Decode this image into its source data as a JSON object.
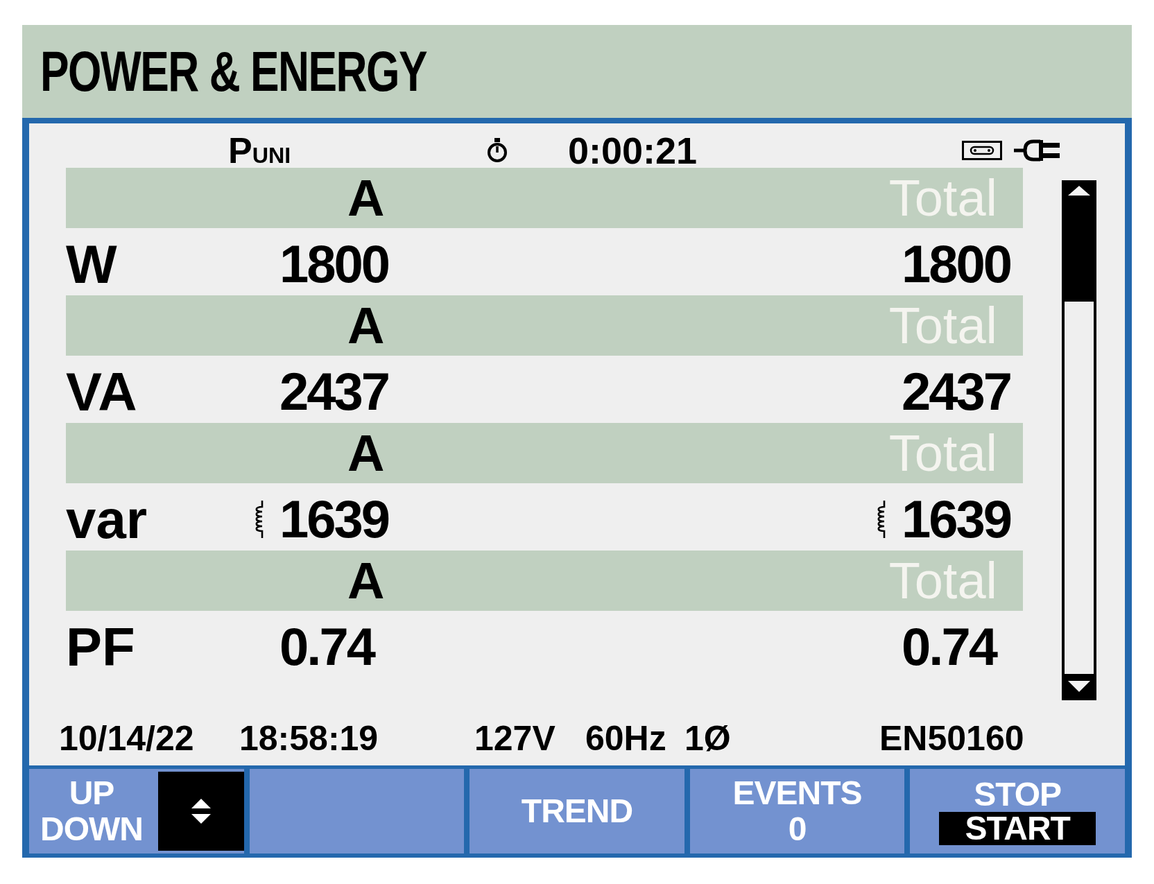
{
  "title": "POWER & ENERGY",
  "info_bar": {
    "mode": "P$_{UNI}$",
    "timer": "0:00:21"
  },
  "measurements": [
    {
      "band": {
        "phase": "A",
        "total": "Total"
      },
      "quantity": "W",
      "phase_value": "1800",
      "total_value": "1800",
      "inductive": false
    },
    {
      "band": {
        "phase": "A",
        "total": "Total"
      },
      "quantity": "VA",
      "phase_value": "2437",
      "total_value": "2437",
      "inductive": false
    },
    {
      "band": {
        "phase": "A",
        "total": "Total"
      },
      "quantity": "var",
      "phase_value": "1639",
      "total_value": "1639",
      "inductive": true
    },
    {
      "band": {
        "phase": "A",
        "total": "Total"
      },
      "quantity": "PF",
      "phase_value": "0.74",
      "total_value": "0.74",
      "inductive": false
    }
  ],
  "status_bar": {
    "date": "10/14/22",
    "time": "18:58:19",
    "voltage": "127V",
    "frequency": "60Hz",
    "wiring": "1Ø",
    "standard": "EN50160"
  },
  "soft_keys": [
    {
      "kind": "arrows",
      "lines": [
        "UP",
        "DOWN"
      ]
    },
    {
      "kind": "blank"
    },
    {
      "kind": "text",
      "lines": [
        "TREND"
      ]
    },
    {
      "kind": "text",
      "lines": [
        "EVENTS",
        "0"
      ]
    },
    {
      "kind": "toggle",
      "options": [
        {
          "label": "STOP",
          "selected": false
        },
        {
          "label": "START",
          "selected": true
        }
      ]
    }
  ]
}
